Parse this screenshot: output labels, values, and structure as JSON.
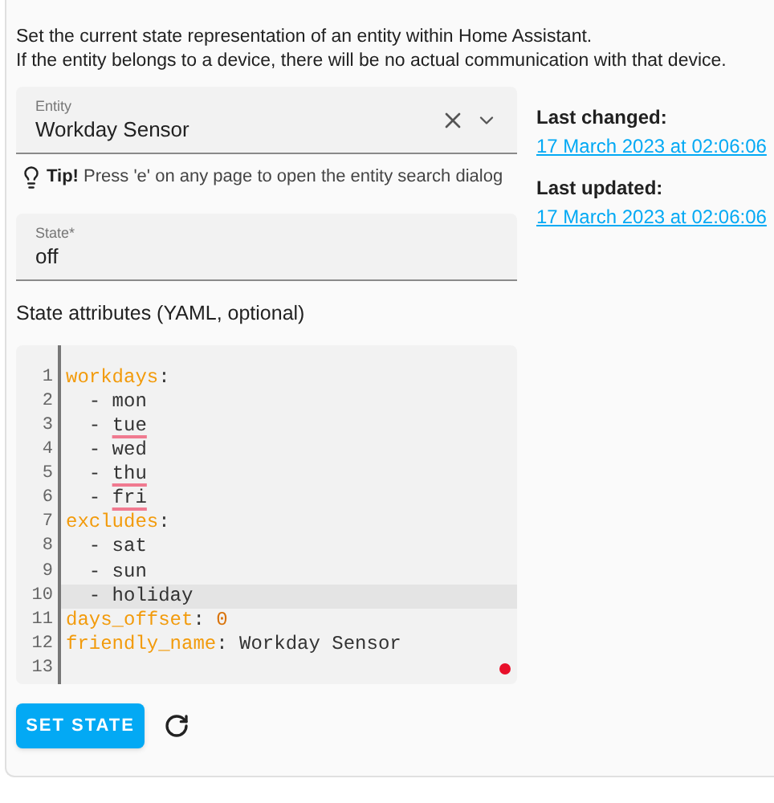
{
  "description": [
    "Set the current state representation of an entity within Home Assistant.",
    "If the entity belongs to a device, there will be no actual communication with that device."
  ],
  "entity_field": {
    "label": "Entity",
    "value": "Workday Sensor"
  },
  "tip": {
    "label": "Tip!",
    "text": "Press 'e' on any page to open the entity search dialog"
  },
  "state_field": {
    "label": "State*",
    "value": "off"
  },
  "attributes_label": "State attributes (YAML, optional)",
  "editor": {
    "lines": [
      {
        "number": "1",
        "highlighted": false,
        "tokens": [
          {
            "kind": "key",
            "text": "workdays"
          },
          {
            "kind": "punct",
            "text": ":"
          }
        ]
      },
      {
        "number": "2",
        "highlighted": false,
        "tokens": [
          {
            "kind": "plain",
            "text": "  - mon"
          }
        ]
      },
      {
        "number": "3",
        "highlighted": false,
        "tokens": [
          {
            "kind": "plain",
            "text": "  - "
          },
          {
            "kind": "flagged",
            "text": "tue"
          }
        ]
      },
      {
        "number": "4",
        "highlighted": false,
        "tokens": [
          {
            "kind": "plain",
            "text": "  - wed"
          }
        ]
      },
      {
        "number": "5",
        "highlighted": false,
        "tokens": [
          {
            "kind": "plain",
            "text": "  - "
          },
          {
            "kind": "flagged",
            "text": "thu"
          }
        ]
      },
      {
        "number": "6",
        "highlighted": false,
        "tokens": [
          {
            "kind": "plain",
            "text": "  - "
          },
          {
            "kind": "flagged",
            "text": "fri"
          }
        ]
      },
      {
        "number": "7",
        "highlighted": false,
        "tokens": [
          {
            "kind": "key",
            "text": "excludes"
          },
          {
            "kind": "punct",
            "text": ":"
          }
        ]
      },
      {
        "number": "8",
        "highlighted": false,
        "tokens": [
          {
            "kind": "plain",
            "text": "  - sat"
          }
        ]
      },
      {
        "number": "9",
        "highlighted": false,
        "tokens": [
          {
            "kind": "plain",
            "text": "  - sun"
          }
        ]
      },
      {
        "number": "10",
        "highlighted": true,
        "tokens": [
          {
            "kind": "plain",
            "text": "  - holiday"
          }
        ]
      },
      {
        "number": "11",
        "highlighted": false,
        "tokens": [
          {
            "kind": "key",
            "text": "days_offset"
          },
          {
            "kind": "punct",
            "text": ": "
          },
          {
            "kind": "number",
            "text": "0"
          }
        ]
      },
      {
        "number": "12",
        "highlighted": false,
        "tokens": [
          {
            "kind": "key",
            "text": "friendly_name"
          },
          {
            "kind": "punct",
            "text": ": Workday Sensor"
          }
        ]
      },
      {
        "number": "13",
        "highlighted": false
      }
    ]
  },
  "set_state_button": "SET STATE",
  "last_changed": {
    "label": "Last changed:",
    "value": "17 March 2023 at 02:06:06"
  },
  "last_updated": {
    "label": "Last updated:",
    "value": "17 March 2023 at 02:06:06"
  }
}
